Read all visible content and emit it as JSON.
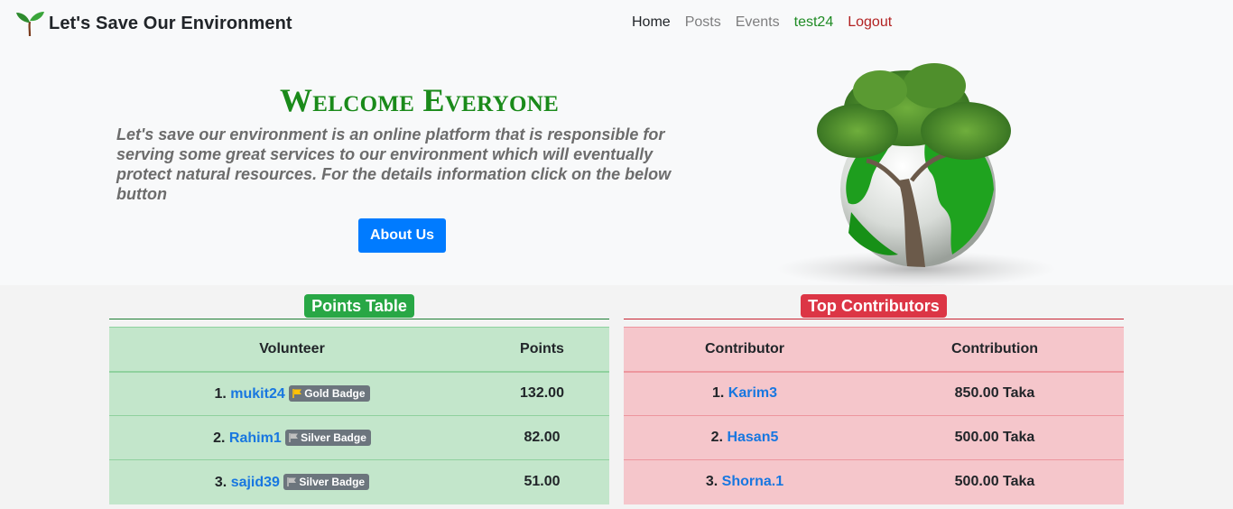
{
  "navbar": {
    "brand": "Let's Save Our Environment",
    "links": [
      {
        "label": "Home"
      },
      {
        "label": "Posts"
      },
      {
        "label": "Events"
      },
      {
        "label": "test24"
      },
      {
        "label": "Logout"
      }
    ]
  },
  "hero": {
    "title": "Welcome Everyone",
    "description": "Let's save our environment is an online platform that is responsible for serving some great services to our environment which will eventually protect natural resources. For the details information click on the below button",
    "button_label": "About Us"
  },
  "points_table": {
    "title": "Points Table",
    "headers": [
      "Volunteer",
      "Points"
    ],
    "rows": [
      {
        "rank": "1.",
        "name": "mukit24",
        "badge": "Gold Badge",
        "badge_color": "#ffc107",
        "points": "132.00"
      },
      {
        "rank": "2.",
        "name": "Rahim1",
        "badge": "Silver Badge",
        "badge_color": "#c0c0c0",
        "points": "82.00"
      },
      {
        "rank": "3.",
        "name": "sajid39",
        "badge": "Silver Badge",
        "badge_color": "#c0c0c0",
        "points": "51.00"
      }
    ]
  },
  "contributors_table": {
    "title": "Top Contributors",
    "headers": [
      "Contributor",
      "Contribution"
    ],
    "rows": [
      {
        "rank": "1.",
        "name": "Karim3",
        "amount": "850.00 Taka"
      },
      {
        "rank": "2.",
        "name": "Hasan5",
        "amount": "500.00 Taka"
      },
      {
        "rank": "3.",
        "name": "Shorna.1",
        "amount": "500.00 Taka"
      }
    ]
  },
  "colors": {
    "primary": "#007bff",
    "success": "#28a745",
    "danger": "#dc3545",
    "link": "#1877e0",
    "user_link": "#1f8b24",
    "logout_link": "#b22222"
  },
  "icons": [
    "sprout-logo-icon",
    "flag-icon",
    "tree-globe-image"
  ]
}
